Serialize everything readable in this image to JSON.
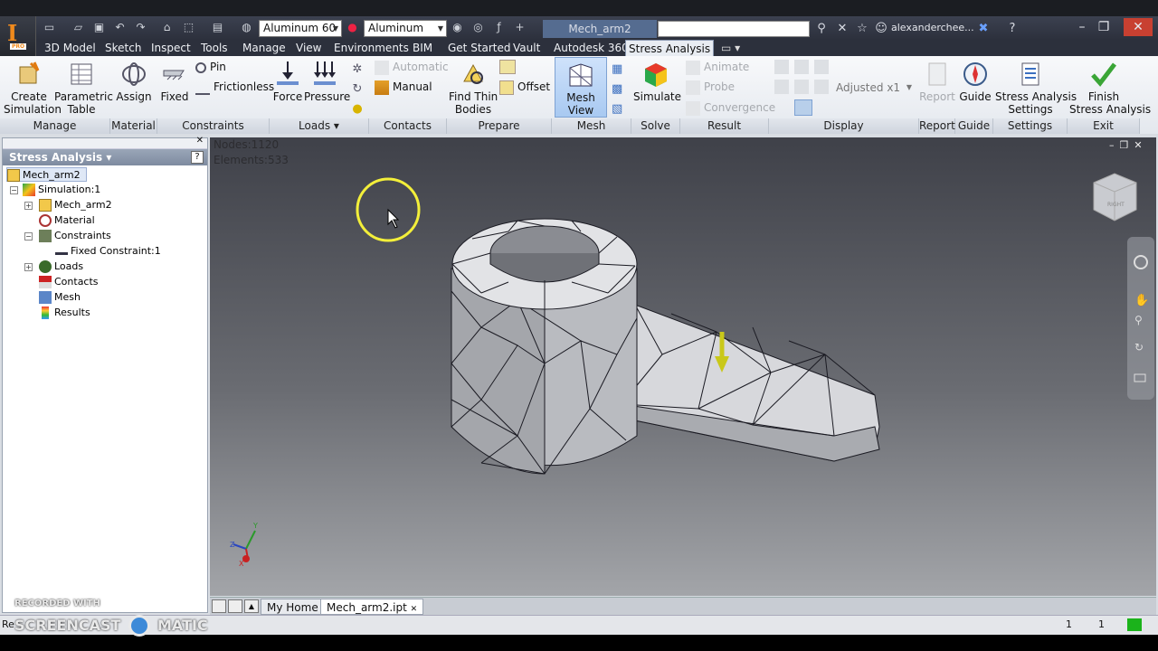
{
  "titlebar": {
    "material_combo": "Aluminum 60",
    "appearance_combo": "Aluminum",
    "document_title": "Mech_arm2",
    "user": "alexanderchee..."
  },
  "menu": [
    "3D Model",
    "Sketch",
    "Inspect",
    "Tools",
    "Manage",
    "View",
    "Environments",
    "BIM",
    "Get Started",
    "Vault",
    "Autodesk 360",
    "Stress Analysis"
  ],
  "ribbon": {
    "manage": {
      "create": "Create\nSimulation",
      "parametric": "Parametric\nTable",
      "label": "Manage"
    },
    "material": {
      "assign": "Assign",
      "label": "Material"
    },
    "constraints": {
      "fixed": "Fixed",
      "pin": "Pin",
      "frictionless": "Frictionless",
      "label": "Constraints"
    },
    "loads": {
      "force": "Force",
      "pressure": "Pressure",
      "label": "Loads"
    },
    "contacts": {
      "automatic": "Automatic",
      "manual": "Manual",
      "label": "Contacts"
    },
    "prepare": {
      "find_thin": "Find Thin\nBodies",
      "offset": "Offset",
      "label": "Prepare"
    },
    "mesh": {
      "view": "Mesh View",
      "label": "Mesh"
    },
    "solve": {
      "simulate": "Simulate",
      "label": "Solve"
    },
    "result": {
      "animate": "Animate",
      "probe": "Probe",
      "convergence": "Convergence",
      "label": "Result"
    },
    "display": {
      "adjusted": "Adjusted x1",
      "label": "Display"
    },
    "report": {
      "report": "Report",
      "label": "Report"
    },
    "guide": {
      "guide": "Guide",
      "label": "Guide"
    },
    "settings": {
      "settings": "Stress Analysis\nSettings",
      "label": "Settings"
    },
    "exit": {
      "finish": "Finish\nStress Analysis",
      "label": "Exit"
    }
  },
  "browser": {
    "title": "Stress Analysis",
    "nodes": [
      {
        "label": "Mech_arm2"
      },
      {
        "label": "Simulation:1"
      },
      {
        "label": "Mech_arm2"
      },
      {
        "label": "Material"
      },
      {
        "label": "Constraints"
      },
      {
        "label": "Fixed Constraint:1"
      },
      {
        "label": "Loads"
      },
      {
        "label": "Contacts"
      },
      {
        "label": "Mesh"
      },
      {
        "label": "Results"
      }
    ]
  },
  "viewport": {
    "nodes": "Nodes:1120",
    "elements": "Elements:533",
    "viewcube": "RIGHT"
  },
  "tabs": [
    "My Home",
    "Mech_arm2.ipt"
  ],
  "status": {
    "left": "Re",
    "count1": "1",
    "count2": "1"
  },
  "watermark": {
    "line1": "RECORDED WITH",
    "line2": "SCREENCAST",
    "line3": "MATIC"
  },
  "colors": {
    "accent": "#f08a1c",
    "active_tab": "#e8ecf2",
    "viewport_top": "#3f4149",
    "load_arrow": "#c9c81a"
  }
}
